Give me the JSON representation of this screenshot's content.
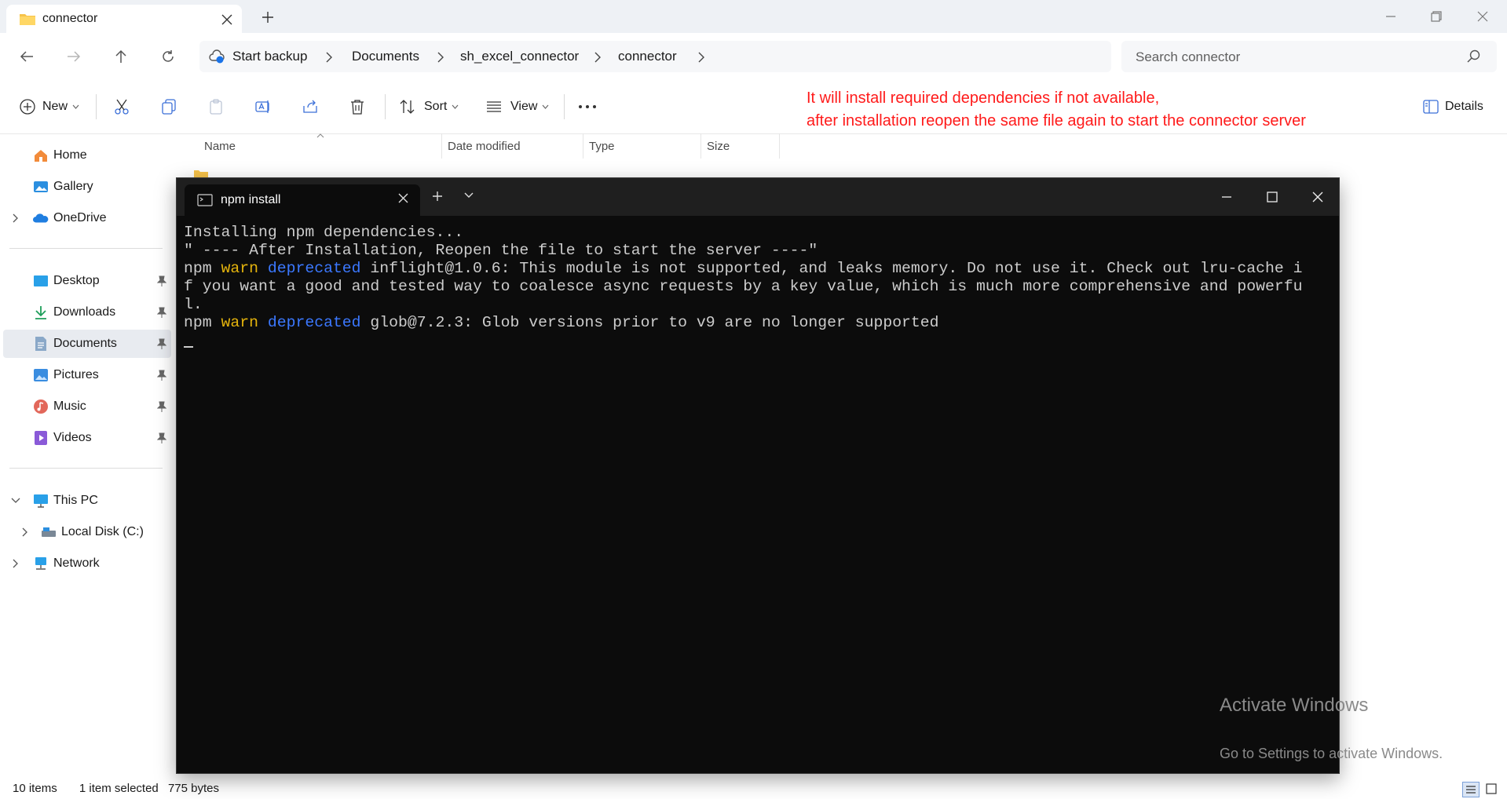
{
  "explorer": {
    "tab_title": "connector",
    "breadcrumbs": [
      "Start backup",
      "Documents",
      "sh_excel_connector",
      "connector"
    ],
    "search_placeholder": "Search connector",
    "commands": {
      "new": "New",
      "sort": "Sort",
      "view": "View",
      "details": "Details"
    },
    "columns": [
      "Name",
      "Date modified",
      "Type",
      "Size"
    ],
    "sidebar": {
      "top": [
        {
          "label": "Home",
          "icon": "home-icon"
        },
        {
          "label": "Gallery",
          "icon": "gallery-icon"
        },
        {
          "label": "OneDrive",
          "icon": "onedrive-icon"
        }
      ],
      "quick": [
        {
          "label": "Desktop",
          "icon": "desktop-icon"
        },
        {
          "label": "Downloads",
          "icon": "downloads-icon"
        },
        {
          "label": "Documents",
          "icon": "documents-icon"
        },
        {
          "label": "Pictures",
          "icon": "pictures-icon"
        },
        {
          "label": "Music",
          "icon": "music-icon"
        },
        {
          "label": "Videos",
          "icon": "videos-icon"
        }
      ],
      "pc": [
        {
          "label": "This PC",
          "icon": "pc-icon"
        },
        {
          "label": "Local Disk (C:)",
          "icon": "disk-icon"
        },
        {
          "label": "Network",
          "icon": "network-icon"
        }
      ]
    },
    "status": {
      "items": "10 items",
      "selected": "1 item selected",
      "size": "775 bytes"
    }
  },
  "notice": {
    "line1": "It will install required dependencies if not available,",
    "line2": "after installation reopen the same file again to start the connector server",
    "color": "#ff1a1a"
  },
  "terminal": {
    "tab_title": "npm install",
    "lines": {
      "l1": "Installing npm dependencies...",
      "l2": "\" ---- After Installation, Reopen the file to start the server ----\"",
      "l3_npm": "npm ",
      "l3_warn": "warn",
      "l3_dep": "deprecated",
      "l3_rest": " inflight@1.0.6: This module is not supported, and leaks memory. Do not use it. Check out lru-cache i",
      "l4": "f you want a good and tested way to coalesce async requests by a key value, which is much more comprehensive and powerfu",
      "l5": "l.",
      "l6_npm": "npm ",
      "l6_warn": "warn",
      "l6_dep": "deprecated",
      "l6_rest": " glob@7.2.3: Glob versions prior to v9 are no longer supported"
    }
  },
  "watermark": {
    "title": "Activate Windows",
    "subtitle": "Go to Settings to activate Windows."
  }
}
